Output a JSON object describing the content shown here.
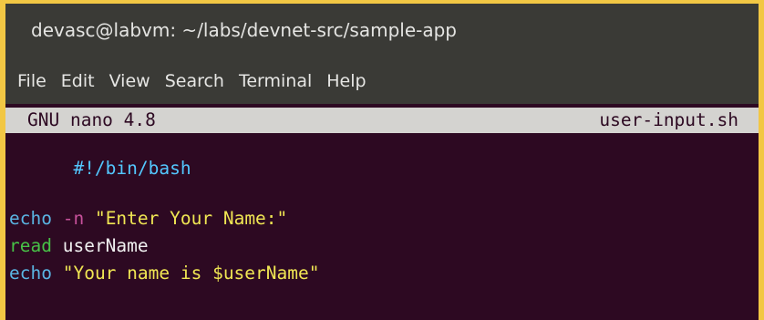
{
  "window": {
    "title": "devasc@labvm: ~/labs/devnet-src/sample-app"
  },
  "menubar": {
    "items": [
      "File",
      "Edit",
      "View",
      "Search",
      "Terminal",
      "Help"
    ]
  },
  "nano": {
    "version": "GNU nano 4.8",
    "filename": "user-input.sh"
  },
  "code": {
    "line1": "#!/bin/bash",
    "line3_cmd": "echo",
    "line3_flag": "-n",
    "line3_str": "\"Enter Your Name:\"",
    "line4_cmd": "read",
    "line4_arg": "userName",
    "line5_cmd": "echo",
    "line5_str": "\"Your name is $userName\""
  },
  "colors": {
    "border_accent": "#f2c744",
    "terminal_bg": "#2d0922",
    "chrome_bg": "#3a3a36",
    "nano_bar_bg": "#d4d3d0"
  }
}
